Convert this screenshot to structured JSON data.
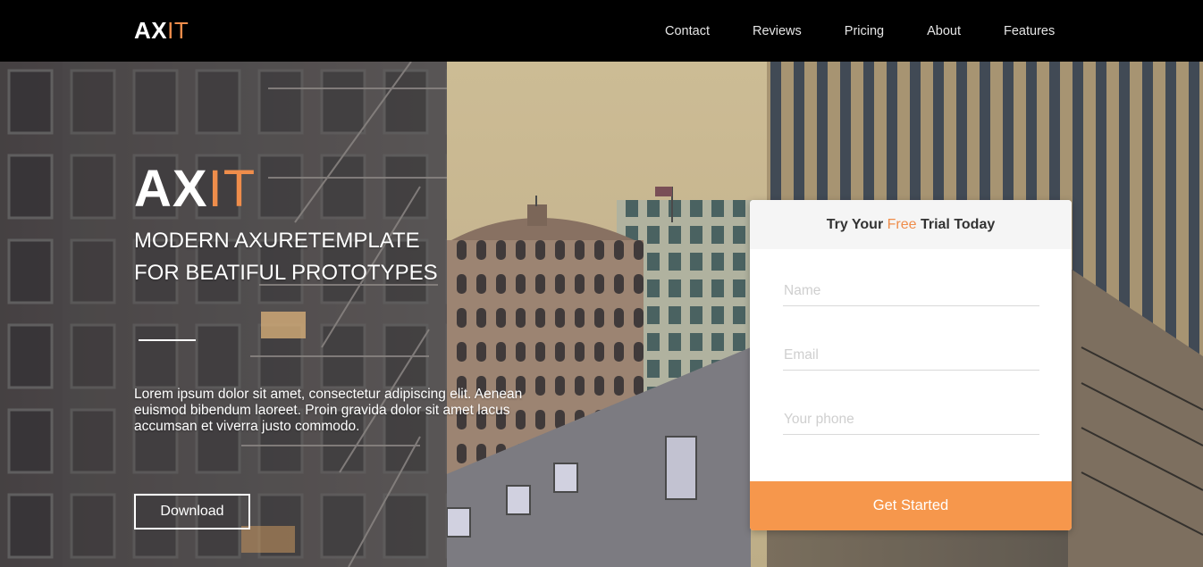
{
  "nav": {
    "logo_main": "AX",
    "logo_accent": "IT",
    "links": [
      "Contact",
      "Reviews",
      "Pricing",
      "About",
      "Features"
    ]
  },
  "hero": {
    "logo_main": "AX",
    "logo_accent": "IT",
    "tagline_line1": "MODERN AXURETEMPLATE",
    "tagline_line2": "FOR BEATIFUL PROTOTYPES",
    "lead": "Lorem ipsum dolor sit amet, consectetur adipiscing elit. Aenean euismod bibendum laoreet. Proin gravida dolor sit amet lacus accumsan et viverra justo commodo.",
    "download_label": "Download"
  },
  "trial": {
    "title_prefix": "Try Your ",
    "title_free": "Free",
    "title_suffix": " Trial Today",
    "name_placeholder": "Name",
    "email_placeholder": "Email",
    "phone_placeholder": "Your phone",
    "submit_label": "Get Started"
  },
  "colors": {
    "accent": "#ef8d4b",
    "button": "#f6974c",
    "header_bg": "#000000"
  }
}
